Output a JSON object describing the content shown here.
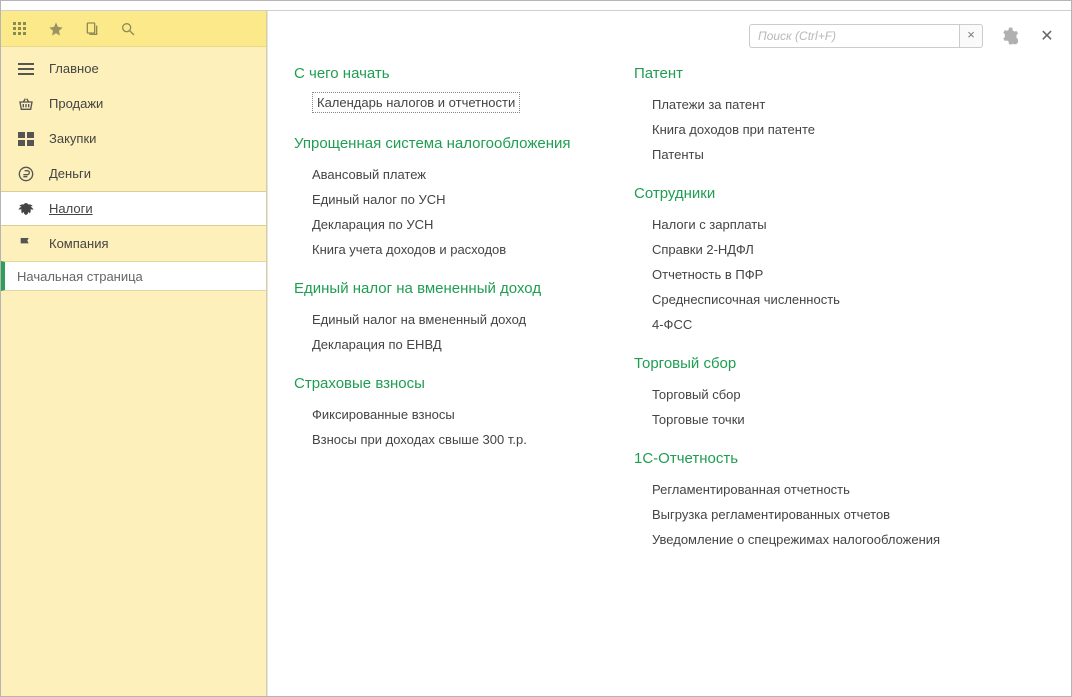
{
  "search": {
    "placeholder": "Поиск (Ctrl+F)"
  },
  "sidebar": {
    "items": [
      {
        "label": "Главное",
        "icon": "menu"
      },
      {
        "label": "Продажи",
        "icon": "basket"
      },
      {
        "label": "Закупки",
        "icon": "boxes"
      },
      {
        "label": "Деньги",
        "icon": "ruble"
      },
      {
        "label": "Налоги",
        "icon": "eagle"
      },
      {
        "label": "Компания",
        "icon": "flag"
      }
    ],
    "active_index": 4,
    "tab": "Начальная страница"
  },
  "columns": {
    "left": [
      {
        "title": "С чего начать",
        "items": [
          {
            "label": "Календарь налогов и отчетности",
            "boxed": true
          }
        ]
      },
      {
        "title": "Упрощенная система налогообложения",
        "items": [
          {
            "label": "Авансовый платеж"
          },
          {
            "label": "Единый налог по УСН"
          },
          {
            "label": "Декларация по УСН"
          },
          {
            "label": "Книга учета доходов и расходов"
          }
        ]
      },
      {
        "title": "Единый налог на вмененный доход",
        "items": [
          {
            "label": "Единый налог на вмененный доход"
          },
          {
            "label": "Декларация по ЕНВД"
          }
        ]
      },
      {
        "title": "Страховые взносы",
        "items": [
          {
            "label": "Фиксированные взносы"
          },
          {
            "label": "Взносы при доходах свыше 300 т.р."
          }
        ]
      }
    ],
    "right": [
      {
        "title": "Патент",
        "items": [
          {
            "label": "Платежи за патент"
          },
          {
            "label": "Книга доходов при патенте"
          },
          {
            "label": "Патенты"
          }
        ]
      },
      {
        "title": "Сотрудники",
        "items": [
          {
            "label": "Налоги с зарплаты"
          },
          {
            "label": "Справки 2-НДФЛ"
          },
          {
            "label": "Отчетность в ПФР"
          },
          {
            "label": "Среднесписочная численность"
          },
          {
            "label": "4-ФСС"
          }
        ]
      },
      {
        "title": "Торговый сбор",
        "items": [
          {
            "label": "Торговый сбор"
          },
          {
            "label": "Торговые точки"
          }
        ]
      },
      {
        "title": "1С-Отчетность",
        "items": [
          {
            "label": "Регламентированная отчетность"
          },
          {
            "label": "Выгрузка регламентированных отчетов"
          },
          {
            "label": "Уведомление о спецрежимах налогообложения"
          }
        ]
      }
    ]
  }
}
